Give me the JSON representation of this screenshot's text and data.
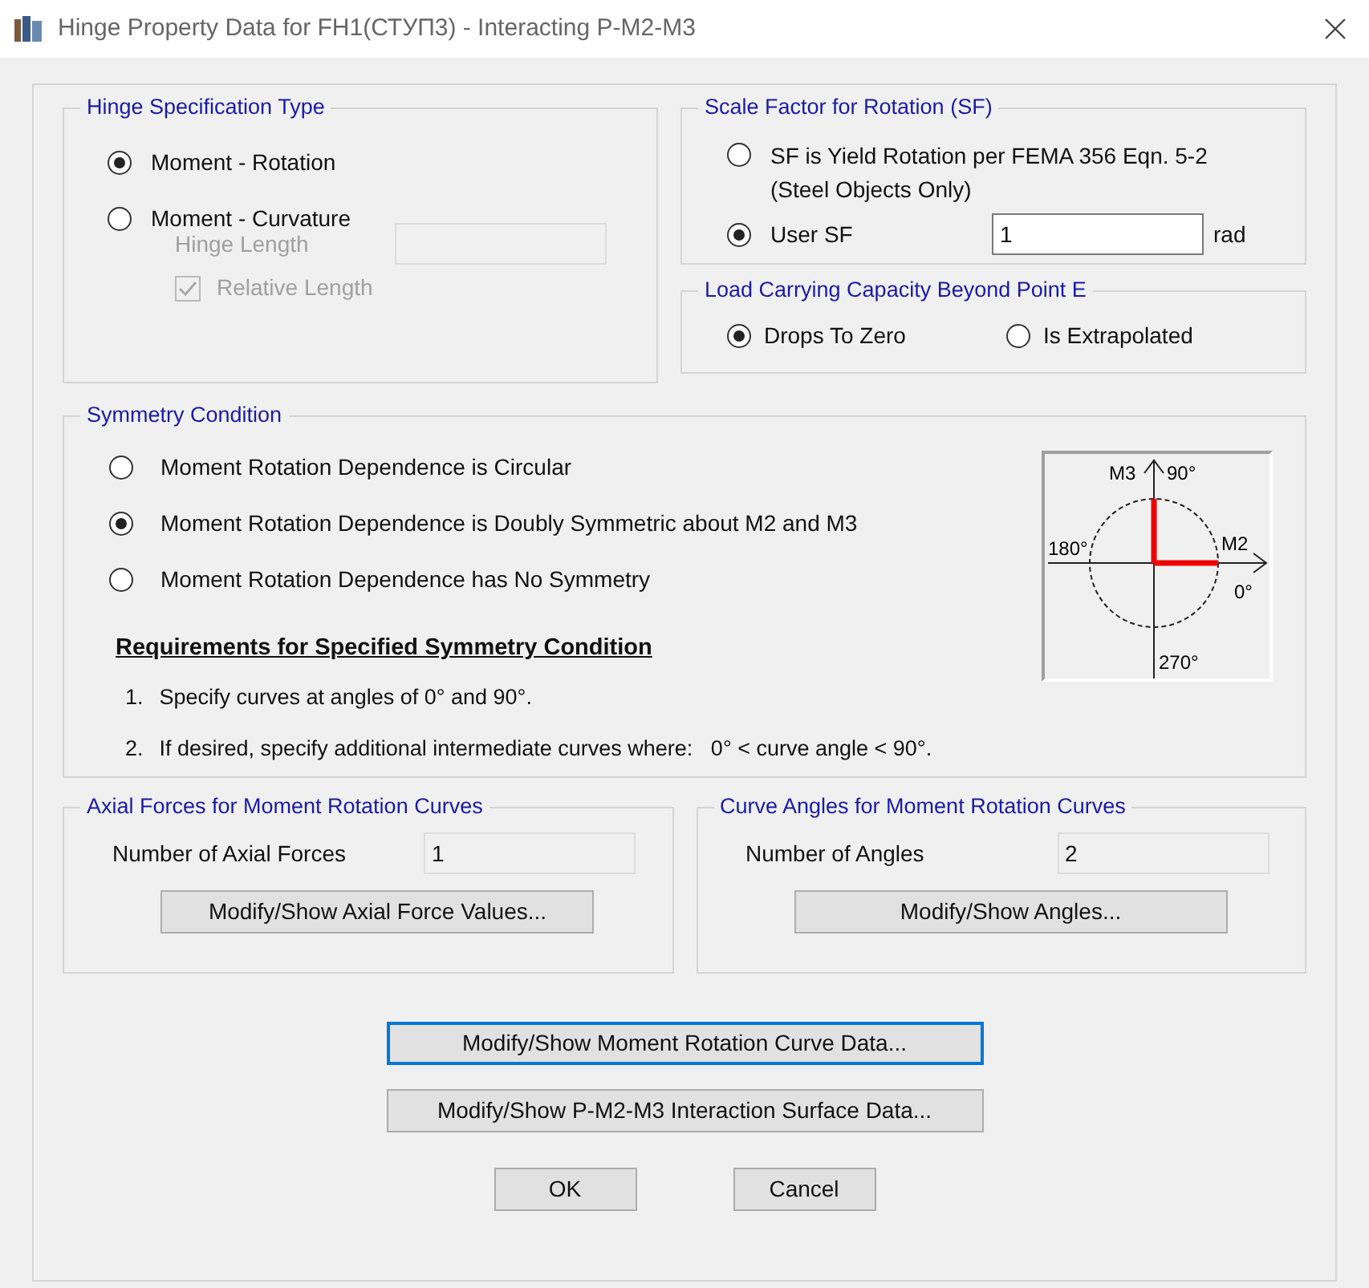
{
  "window": {
    "title": "Hinge Property Data for FH1(СТУП3) - Interacting P-M2-M3"
  },
  "hinge_specification_type": {
    "title": "Hinge Specification Type",
    "options": [
      {
        "label": "Moment - Rotation",
        "selected": true
      },
      {
        "label": "Moment - Curvature",
        "selected": false
      }
    ],
    "hinge_length": {
      "label": "Hinge Length",
      "disabled": true
    },
    "relative_length": {
      "label": "Relative Length",
      "checked": true,
      "disabled": true
    }
  },
  "scale_factor": {
    "title": "Scale Factor for Rotation (SF)",
    "options": [
      {
        "label": "SF is Yield Rotation per FEMA 356 Eqn. 5-2",
        "note": "(Steel Objects Only)",
        "selected": false
      },
      {
        "label": "User SF",
        "selected": true,
        "value": "1",
        "unit": "rad"
      }
    ]
  },
  "load_capacity": {
    "title": "Load Carrying Capacity Beyond Point E",
    "options": [
      {
        "label": "Drops To Zero",
        "selected": true
      },
      {
        "label": "Is Extrapolated",
        "selected": false
      }
    ]
  },
  "symmetry_condition": {
    "title": "Symmetry Condition",
    "options": [
      {
        "label": "Moment Rotation Dependence is Circular",
        "selected": false
      },
      {
        "label": "Moment Rotation Dependence is Doubly Symmetric about M2 and M3",
        "selected": true
      },
      {
        "label": "Moment Rotation Dependence has No Symmetry",
        "selected": false
      }
    ],
    "requirements_title": "Requirements for Specified Symmetry Condition",
    "requirements": [
      {
        "number": "1.",
        "text": "Specify curves at angles of 0° and 90°."
      },
      {
        "number": "2.",
        "text": "If desired, specify additional intermediate curves where:   0° < curve angle < 90°."
      }
    ],
    "diagram": {
      "m3": "M3",
      "angle_90": "90°",
      "m2": "M2",
      "angle_0": "0°",
      "angle_180": "180°",
      "angle_270": "270°"
    }
  },
  "axial_forces": {
    "title": "Axial Forces for Moment Rotation Curves",
    "label": "Number of Axial Forces",
    "value": "1",
    "button": "Modify/Show Axial Force Values..."
  },
  "curve_angles": {
    "title": "Curve Angles for Moment Rotation Curves",
    "label": "Number of Angles",
    "value": "2",
    "button": "Modify/Show Angles..."
  },
  "actions": [
    {
      "label": "Modify/Show Moment Rotation Curve Data...",
      "focused": true
    },
    {
      "label": "Modify/Show P-M2-M3 Interaction Surface Data...",
      "focused": false
    }
  ],
  "buttons": [
    {
      "label": "OK"
    },
    {
      "label": "Cancel"
    }
  ]
}
